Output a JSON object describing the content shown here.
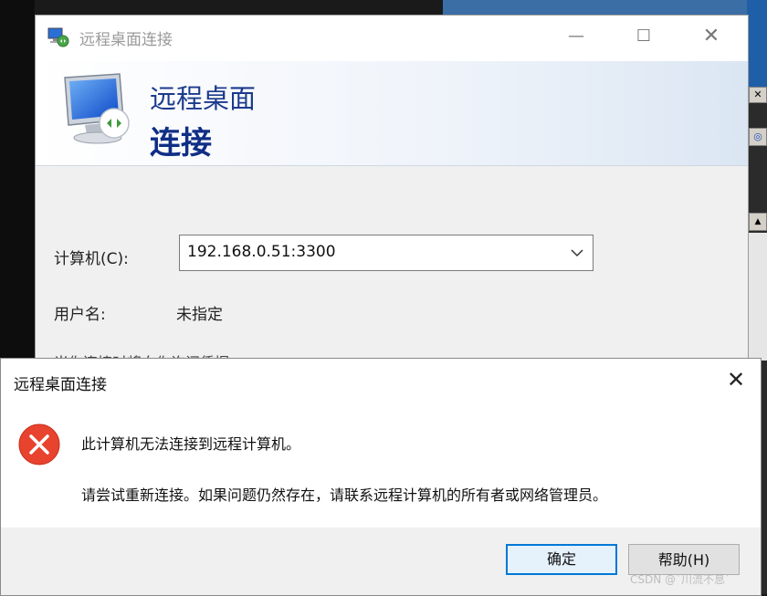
{
  "rdp_window": {
    "title": "远程桌面连接",
    "banner_line1": "远程桌面",
    "banner_line2": "连接",
    "computer_label": "计算机(C):",
    "computer_value": "192.168.0.51:3300",
    "username_label": "用户名:",
    "username_value": "未指定",
    "partial_text": "当你连接时将向你询问凭据"
  },
  "error_dialog": {
    "title": "远程桌面连接",
    "message_primary": "此计算机无法连接到远程计算机。",
    "message_secondary": "请尝试重新连接。如果问题仍然存在，请联系远程计算机的所有者或网络管理员。",
    "ok_button": "确定",
    "help_button": "帮助(H)"
  },
  "watermark": "CSDN @`川流不息`",
  "colors": {
    "banner_text": "#1b3a8c",
    "error_red": "#e8432e",
    "default_button_border": "#0078d7"
  },
  "icons": [
    "rdp-app-icon",
    "monitor-icon",
    "minimize-icon",
    "maximize-icon",
    "close-icon",
    "chevron-down-icon",
    "error-icon"
  ]
}
